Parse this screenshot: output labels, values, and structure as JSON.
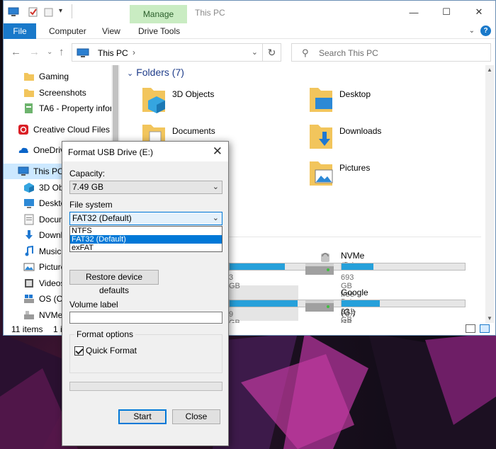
{
  "window": {
    "title": "This PC",
    "manage_tab": "Manage",
    "controls": {
      "minimize": "—",
      "maximize": "☐",
      "close": "✕"
    }
  },
  "ribbon": {
    "tabs": [
      "File",
      "Computer",
      "View",
      "Drive Tools"
    ]
  },
  "address": {
    "path": "This PC",
    "search_placeholder": "Search This PC"
  },
  "nav": {
    "items": [
      {
        "label": "Gaming",
        "icon": "folder-icon"
      },
      {
        "label": "Screenshots",
        "icon": "folder-icon"
      },
      {
        "label": "TA6 - Property inforr",
        "icon": "document-icon"
      },
      {
        "label": "Creative Cloud Files",
        "icon": "creative-cloud-icon"
      },
      {
        "label": "OneDrive",
        "icon": "onedrive-icon"
      },
      {
        "label": "This PC",
        "icon": "computer-icon",
        "selected": true
      },
      {
        "label": "3D Obje",
        "icon": "3d-objects-icon"
      },
      {
        "label": "Desktop",
        "icon": "desktop-icon"
      },
      {
        "label": "Docum",
        "icon": "documents-icon"
      },
      {
        "label": "Downlo",
        "icon": "downloads-icon"
      },
      {
        "label": "Music",
        "icon": "music-icon"
      },
      {
        "label": "Picture",
        "icon": "pictures-icon"
      },
      {
        "label": "Videos",
        "icon": "videos-icon"
      },
      {
        "label": "OS (C:)",
        "icon": "os-drive-icon"
      },
      {
        "label": "NVMe (",
        "icon": "drive-icon"
      }
    ]
  },
  "content": {
    "group_folders": "Folders (7)",
    "folders": [
      "3D Objects",
      "Desktop",
      "Documents",
      "Downloads",
      "Pictures"
    ],
    "drives": [
      {
        "name": "",
        "free": "3 GB",
        "used_fraction": 0.45
      },
      {
        "name": "NVMe (D:)",
        "free": "693 GB free of 931 GB",
        "used_fraction": 0.26
      },
      {
        "name": "",
        "free": "9 GB",
        "used_fraction": 0.55
      },
      {
        "name": "Google Drive (G:)",
        "free": "70.7 GB free of 102 GB",
        "used_fraction": 0.31
      }
    ]
  },
  "status": {
    "items": "11 items",
    "selected": "1 i"
  },
  "dialog": {
    "title": "Format USB Drive (E:)",
    "capacity_label": "Capacity:",
    "capacity_value": "7.49 GB",
    "filesystem_label": "File system",
    "filesystem_value": "FAT32 (Default)",
    "filesystem_options": [
      "NTFS",
      "FAT32 (Default)",
      "exFAT"
    ],
    "restore_button": "Restore device defaults",
    "volume_label": "Volume label",
    "volume_value": "",
    "format_options_label": "Format options",
    "quick_format_label": "Quick Format",
    "quick_format_checked": true,
    "progress": 0,
    "start_button": "Start",
    "close_button": "Close"
  }
}
